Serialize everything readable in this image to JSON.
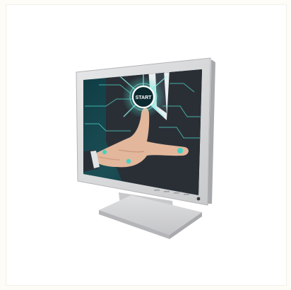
{
  "product": {
    "image_description_label": "",
    "screen_button_text": "START"
  },
  "colors": {
    "background": "#fdfcf7",
    "bezel": "#d9dadb",
    "bezel_shade": "#b9babd",
    "screen_dark": "#0f2b33",
    "accent_teal": "#43d1c2",
    "suit": "#2a2f36",
    "skin": "#e2b79b"
  }
}
